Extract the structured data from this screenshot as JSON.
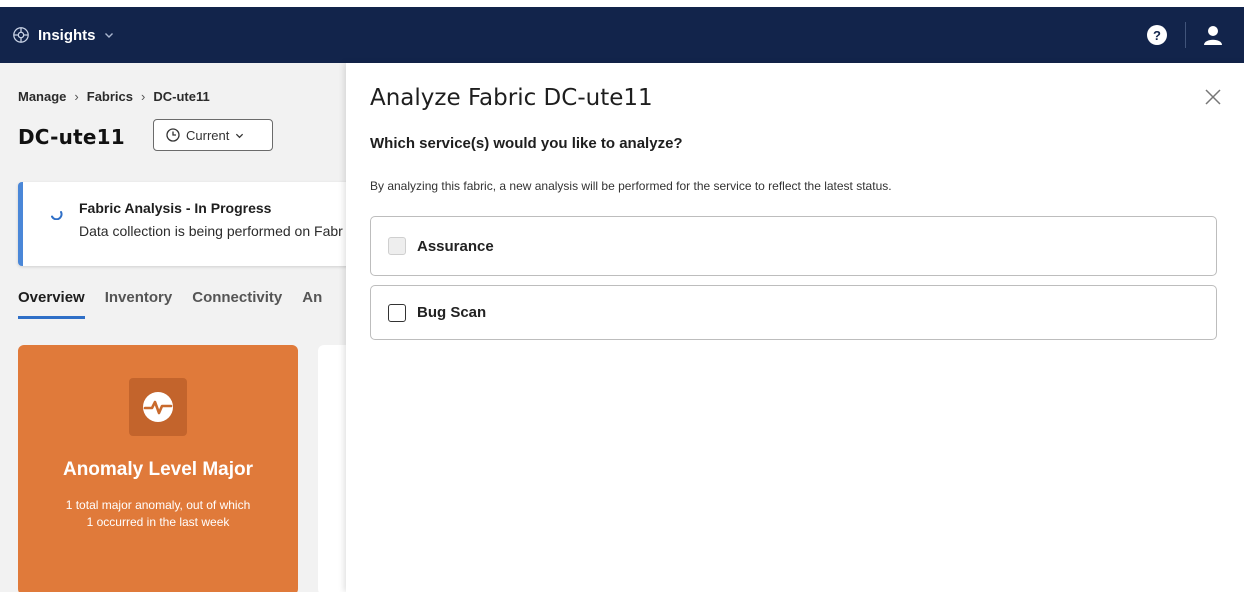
{
  "app": {
    "name": "Insights"
  },
  "header": {
    "help_label": "?"
  },
  "breadcrumb": [
    "Manage",
    "Fabrics",
    "DC-ute11"
  ],
  "page": {
    "title": "DC-ute11",
    "time_selector": "Current"
  },
  "progress": {
    "title": "Fabric Analysis - In Progress",
    "description": "Data collection is being performed on Fabr"
  },
  "tabs": [
    {
      "label": "Overview",
      "active": true
    },
    {
      "label": "Inventory",
      "active": false
    },
    {
      "label": "Connectivity",
      "active": false
    },
    {
      "label": "An",
      "active": false
    }
  ],
  "anomaly": {
    "title": "Anomaly Level Major",
    "line1": "1 total major anomaly, out of which",
    "line2": "1 occurred in the last week",
    "color": "#e07a3a"
  },
  "drawer": {
    "title": "Analyze Fabric DC-ute11",
    "question": "Which service(s) would you like to analyze?",
    "help_text": "By analyzing this fabric, a new analysis will be performed for the service to reflect the latest status.",
    "options": [
      {
        "label": "Assurance",
        "checked": false,
        "disabled": true
      },
      {
        "label": "Bug Scan",
        "checked": false,
        "disabled": false
      }
    ]
  },
  "colors": {
    "header_bg": "#12244b",
    "accent": "#2f6fc7",
    "progress_border": "#4a87d8"
  },
  "icons": [
    "insights-logo-icon",
    "chevron-down-icon",
    "help-icon",
    "user-icon",
    "clock-icon",
    "spinner-icon",
    "pulse-icon",
    "close-icon"
  ]
}
